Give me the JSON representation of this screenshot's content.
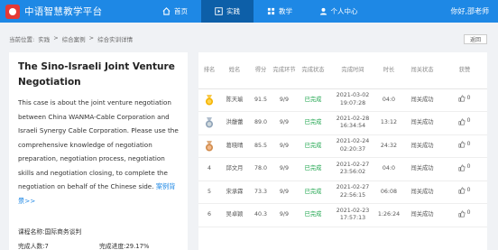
{
  "app": {
    "title": "中语智慧教学平台"
  },
  "nav": {
    "home": "首页",
    "practice": "实践",
    "teaching": "教学",
    "personal": "个人中心",
    "greeting": "你好,邵老师"
  },
  "breadcrumb": {
    "prefix": "当前位置:",
    "items": [
      "实践",
      "综合案例",
      "综合实训详情"
    ]
  },
  "back_label": "返回",
  "case": {
    "title": "The Sino-Israeli Joint Venture Negotiation",
    "description": "This case is about the joint venture negotiation between China WANMA-Cable Corporation and Israeli Synergy Cable Corporation. Please use the comprehensive knowledge of negotiation preparation, negotiation process, negotiation skills and negotiation closing, to complete the negotiation on behalf of the Chinese side.",
    "more_link": "案例背景>>",
    "course": "课程名称:国际商务谈判",
    "completed": "完成人数:7",
    "progress": "完成进度:29.17%"
  },
  "table": {
    "headers": [
      "排名",
      "姓名",
      "得分",
      "完成环节",
      "完成状态",
      "完成时间",
      "时长",
      "闯关状态",
      "获赞"
    ],
    "rows": [
      {
        "rank": "",
        "medal": "gold",
        "name": "陈天瑜",
        "score": "91.5",
        "steps": "9/9",
        "status": "已完成",
        "date": "2021-03-02",
        "time": "19:07:28",
        "duration": "04:0",
        "pass": "闯关成功",
        "likes": "0"
      },
      {
        "rank": "",
        "medal": "silver",
        "name": "洪馥蕾",
        "score": "89.0",
        "steps": "9/9",
        "status": "已完成",
        "date": "2021-02-28",
        "time": "16:34:54",
        "duration": "13:12",
        "pass": "闯关成功",
        "likes": "0"
      },
      {
        "rank": "",
        "medal": "bronze",
        "name": "葛晓晴",
        "score": "85.5",
        "steps": "9/9",
        "status": "已完成",
        "date": "2021-02-24",
        "time": "02:20:37",
        "duration": "24:32",
        "pass": "闯关成功",
        "likes": "0"
      },
      {
        "rank": "4",
        "medal": "",
        "name": "邱文月",
        "score": "78.0",
        "steps": "9/9",
        "status": "已完成",
        "date": "2021-02-27",
        "time": "23:56:02",
        "duration": "04:0",
        "pass": "闯关成功",
        "likes": "0"
      },
      {
        "rank": "5",
        "medal": "",
        "name": "宋承霖",
        "score": "73.3",
        "steps": "9/9",
        "status": "已完成",
        "date": "2021-02-27",
        "time": "22:56:15",
        "duration": "06:08",
        "pass": "闯关成功",
        "likes": "0"
      },
      {
        "rank": "6",
        "medal": "",
        "name": "吴卓颖",
        "score": "40.3",
        "steps": "9/9",
        "status": "已完成",
        "date": "2021-02-23",
        "time": "17:57:13",
        "duration": "1:26:24",
        "pass": "闯关成功",
        "likes": "0"
      }
    ]
  },
  "colors": {
    "nav": "#1e88e5",
    "nav_active": "#0d5fa8",
    "status_green": "#1aa34a",
    "logo_red": "#e53935"
  }
}
